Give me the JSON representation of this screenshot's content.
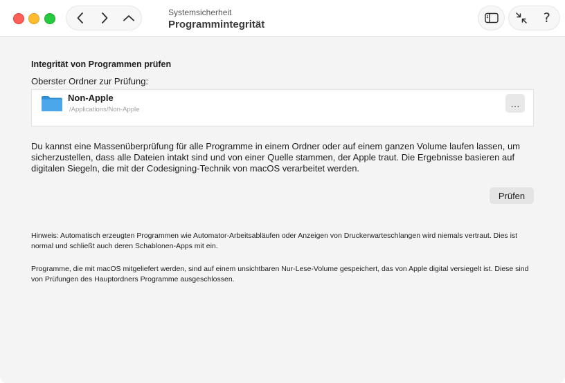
{
  "window": {
    "subtitle": "Systemsicherheit",
    "title": "Programmintegrität",
    "traffic_lights": {
      "close": "#fe5f57",
      "minimize": "#febc2e",
      "maximize": "#28c840"
    }
  },
  "toolbar": {
    "nav_icons": [
      "chevron-left-icon",
      "chevron-right-icon",
      "chevron-up-icon"
    ],
    "right_icons": [
      "sidebar-icon",
      "collapse-icon",
      "help-icon"
    ],
    "help_glyph": "?"
  },
  "main": {
    "section_title": "Integrität von Programmen prüfen",
    "folder_label": "Oberster Ordner zur Prüfung:",
    "folder": {
      "name": "Non-Apple",
      "path": "/Applications/Non-Apple",
      "more_label": "…",
      "icon_color": "#4ba7ea"
    },
    "description": "Du kannst eine Massenüberprüfung für alle Programme in einem Ordner oder auf einem ganzen Volume laufen lassen, um sicherzustellen, dass alle Dateien intakt sind und von einer Quelle stammen, der Apple traut. Die Ergebnisse basieren auf digitalen Siegeln, die mit der Codesigning-Technik von macOS verarbeitet werden.",
    "check_button": "Prüfen",
    "note_1": "Hinweis: Automatisch erzeugten Programmen wie Automator-Arbeitsabläufen oder Anzeigen von Druckerwarteschlangen wird niemals vertraut. Dies ist normal und schließt auch deren Schablonen-Apps mit ein.",
    "note_2": "Programme, die mit macOS mitgeliefert werden, sind auf einem unsichtbaren Nur-Lese-Volume gespeichert, das von Apple digital versiegelt ist. Diese sind von Prüfungen des Hauptordners Programme ausgeschlossen."
  }
}
